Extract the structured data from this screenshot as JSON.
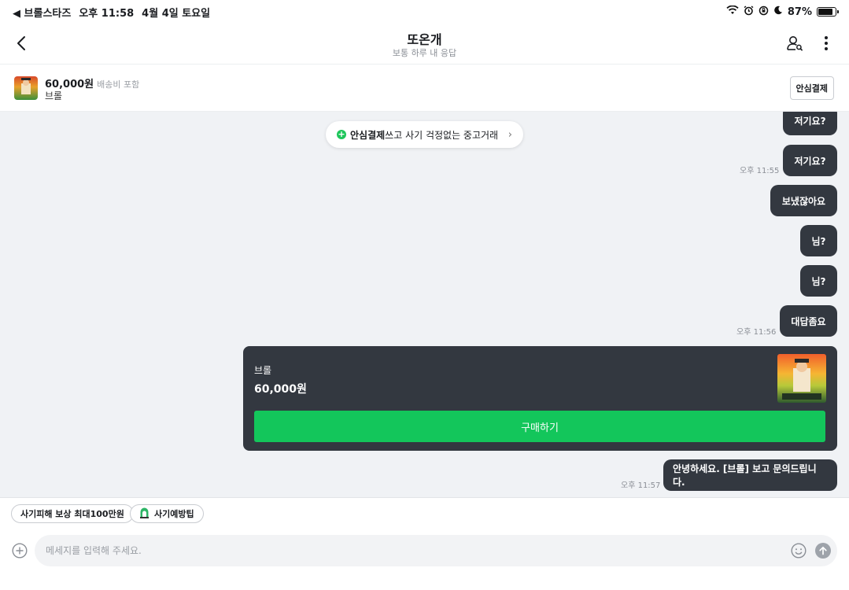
{
  "status_bar": {
    "back_app": "◀ 브롤스타즈",
    "time": "오후 11:58",
    "date": "4월 4일 토요일",
    "battery": "87%",
    "battery_level": 0.87
  },
  "header": {
    "title": "또온개",
    "subtitle": "보통 하루 내 응답"
  },
  "product": {
    "price": "60,000원",
    "price_note": "배송비 포함",
    "name": "브롤",
    "safe_pay_button": "안심결제"
  },
  "banner": {
    "bold": "안심결제",
    "text": "쓰고 사기 걱정없는 중고거래"
  },
  "messages": [
    {
      "text": "저기요?",
      "time": ""
    },
    {
      "text": "저기요?",
      "time": "오후 11:55"
    },
    {
      "text": "보냈잖아요",
      "time": ""
    },
    {
      "text": "님?",
      "time": ""
    },
    {
      "text": "님?",
      "time": ""
    },
    {
      "text": "대답좀요",
      "time": "오후 11:56"
    }
  ],
  "product_card": {
    "name": "브롤",
    "price": "60,000원",
    "buy_button": "구매하기"
  },
  "last_message": {
    "text": "안녕하세요. [브롤] 보고 문의드립니다.",
    "time": "오후 11:57"
  },
  "chips": {
    "compensation": "사기피해 보상 최대100만원",
    "tips": "사기예방팁"
  },
  "composer": {
    "placeholder": "메세지를 입력해 주세요."
  },
  "colors": {
    "bubble": "#333840",
    "accent_green": "#13c65b",
    "chat_bg": "#f0f2f5"
  }
}
